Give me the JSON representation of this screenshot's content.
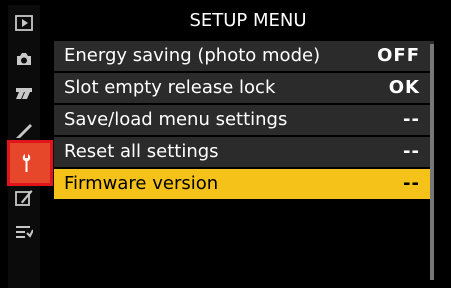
{
  "header": {
    "title": "SETUP MENU"
  },
  "sidebar": {
    "items": [
      {
        "icon": "playback-icon"
      },
      {
        "icon": "camera-icon"
      },
      {
        "icon": "movie-icon"
      },
      {
        "icon": "pencil-icon"
      },
      {
        "icon": "wrench-icon"
      },
      {
        "icon": "retouch-icon"
      },
      {
        "icon": "recent-settings-icon"
      }
    ]
  },
  "menu": {
    "items": [
      {
        "label": "Energy saving (photo mode)",
        "value": "OFF"
      },
      {
        "label": "Slot empty release lock",
        "value": "OK"
      },
      {
        "label": "Save/load menu settings",
        "value": "--"
      },
      {
        "label": "Reset all settings",
        "value": "--"
      },
      {
        "label": "Firmware version",
        "value": "--"
      }
    ]
  },
  "colors": {
    "background": "#000000",
    "row": "#2b2b2b",
    "selected_row": "#f5c21a",
    "highlight_red": "#e0141b",
    "active_icon_bg": "#e6472b"
  }
}
